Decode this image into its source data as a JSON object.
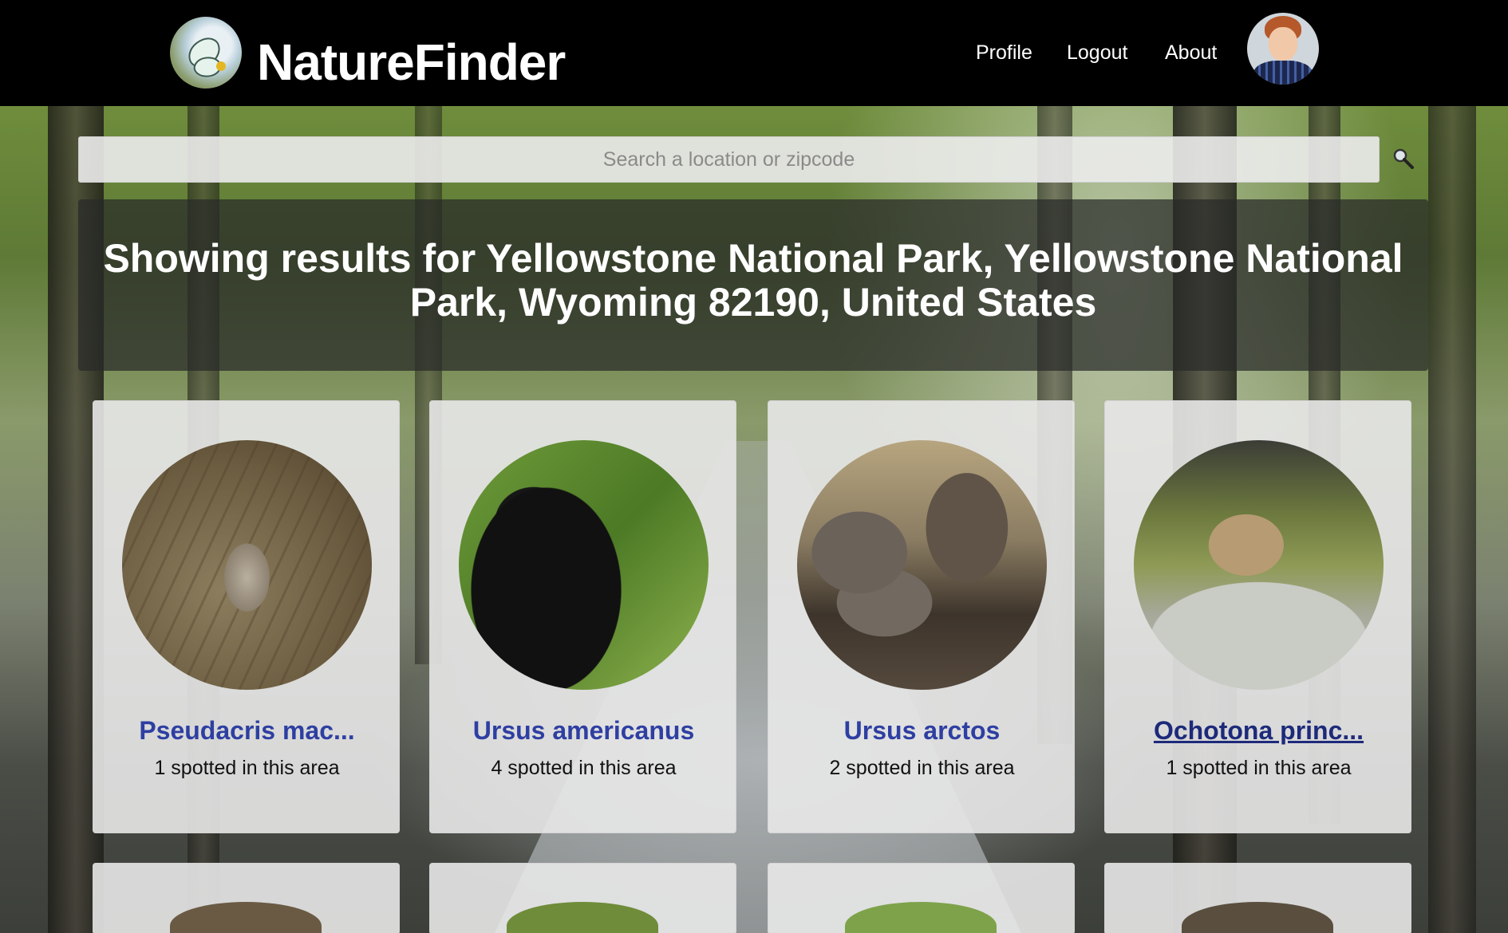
{
  "header": {
    "brand": "NatureFinder",
    "nav": [
      {
        "label": "Profile"
      },
      {
        "label": "Logout"
      },
      {
        "label": "About"
      }
    ]
  },
  "search": {
    "placeholder": "Search a location or zipcode",
    "icon": "magnifier-icon"
  },
  "results": {
    "heading": "Showing results for Yellowstone National Park, Yellowstone National Park, Wyoming 82190, United States"
  },
  "species": [
    {
      "name": "Pseudacris mac...",
      "count_text": "1 spotted in this area"
    },
    {
      "name": "Ursus americanus",
      "count_text": "4 spotted in this area"
    },
    {
      "name": "Ursus arctos",
      "count_text": "2 spotted in this area"
    },
    {
      "name": "Ochotona princ...",
      "count_text": "1 spotted in this area"
    }
  ],
  "colors": {
    "header_bg": "#000000",
    "link": "#2e3fa2",
    "link_visited": "#1d2a7a"
  }
}
